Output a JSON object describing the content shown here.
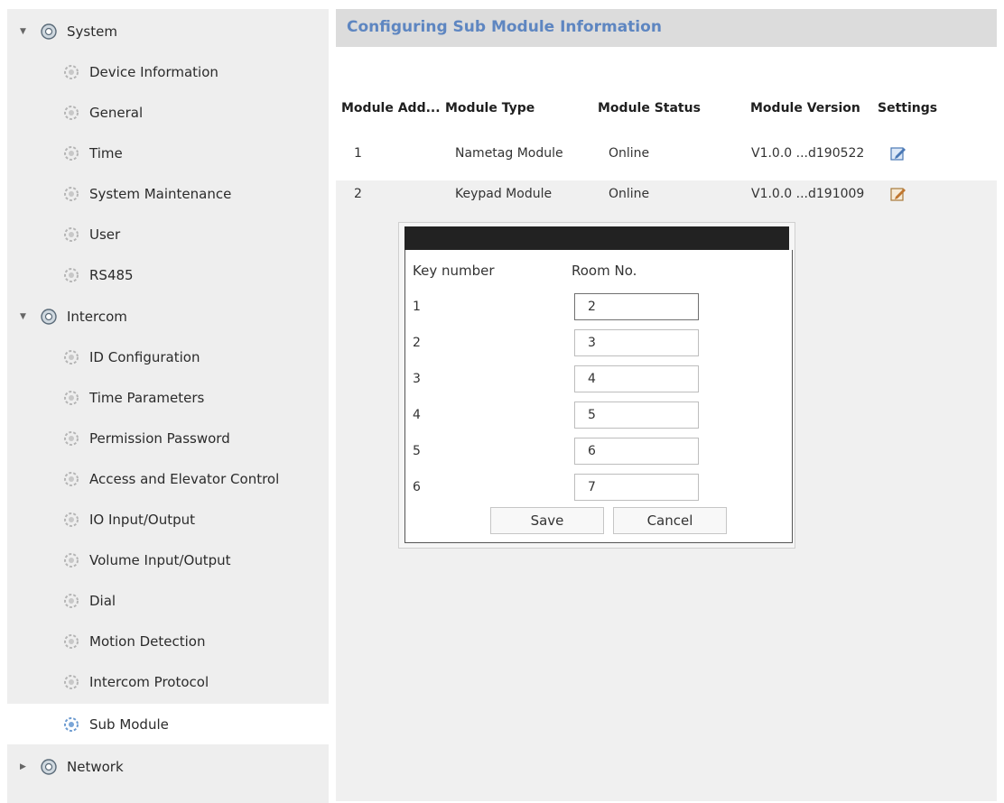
{
  "sidebar": {
    "groups": [
      {
        "label": "System"
      },
      {
        "label": "Intercom"
      },
      {
        "label": "Network"
      }
    ],
    "system_items": [
      "Device Information",
      "General",
      "Time",
      "System Maintenance",
      "User",
      "RS485"
    ],
    "intercom_items": [
      "ID Configuration",
      "Time Parameters",
      "Permission Password",
      "Access and Elevator Control",
      "IO Input/Output",
      "Volume Input/Output",
      "Dial",
      "Motion Detection",
      "Intercom Protocol",
      "Sub Module"
    ]
  },
  "main": {
    "title": "Configuring Sub Module Information",
    "columns": [
      "Module Add...",
      "Module Type",
      "Module Status",
      "Module Version",
      "Settings"
    ],
    "rows": [
      {
        "address": "1",
        "type": "Nametag Module",
        "status": "Online",
        "version": "V1.0.0 ...d190522"
      },
      {
        "address": "2",
        "type": "Keypad Module",
        "status": "Online",
        "version": "V1.0.0 ...d191009"
      }
    ]
  },
  "dialog": {
    "header_key": "Key number",
    "header_room": "Room No.",
    "entries": [
      {
        "key": "1",
        "room": "2"
      },
      {
        "key": "2",
        "room": "3"
      },
      {
        "key": "3",
        "room": "4"
      },
      {
        "key": "4",
        "room": "5"
      },
      {
        "key": "5",
        "room": "6"
      },
      {
        "key": "6",
        "room": "7"
      }
    ],
    "save_label": "Save",
    "cancel_label": "Cancel"
  },
  "colors": {
    "title_text": "#5e86c1",
    "sidebar_bg": "#eeeeee",
    "dialog_titlebar": "#222222"
  }
}
